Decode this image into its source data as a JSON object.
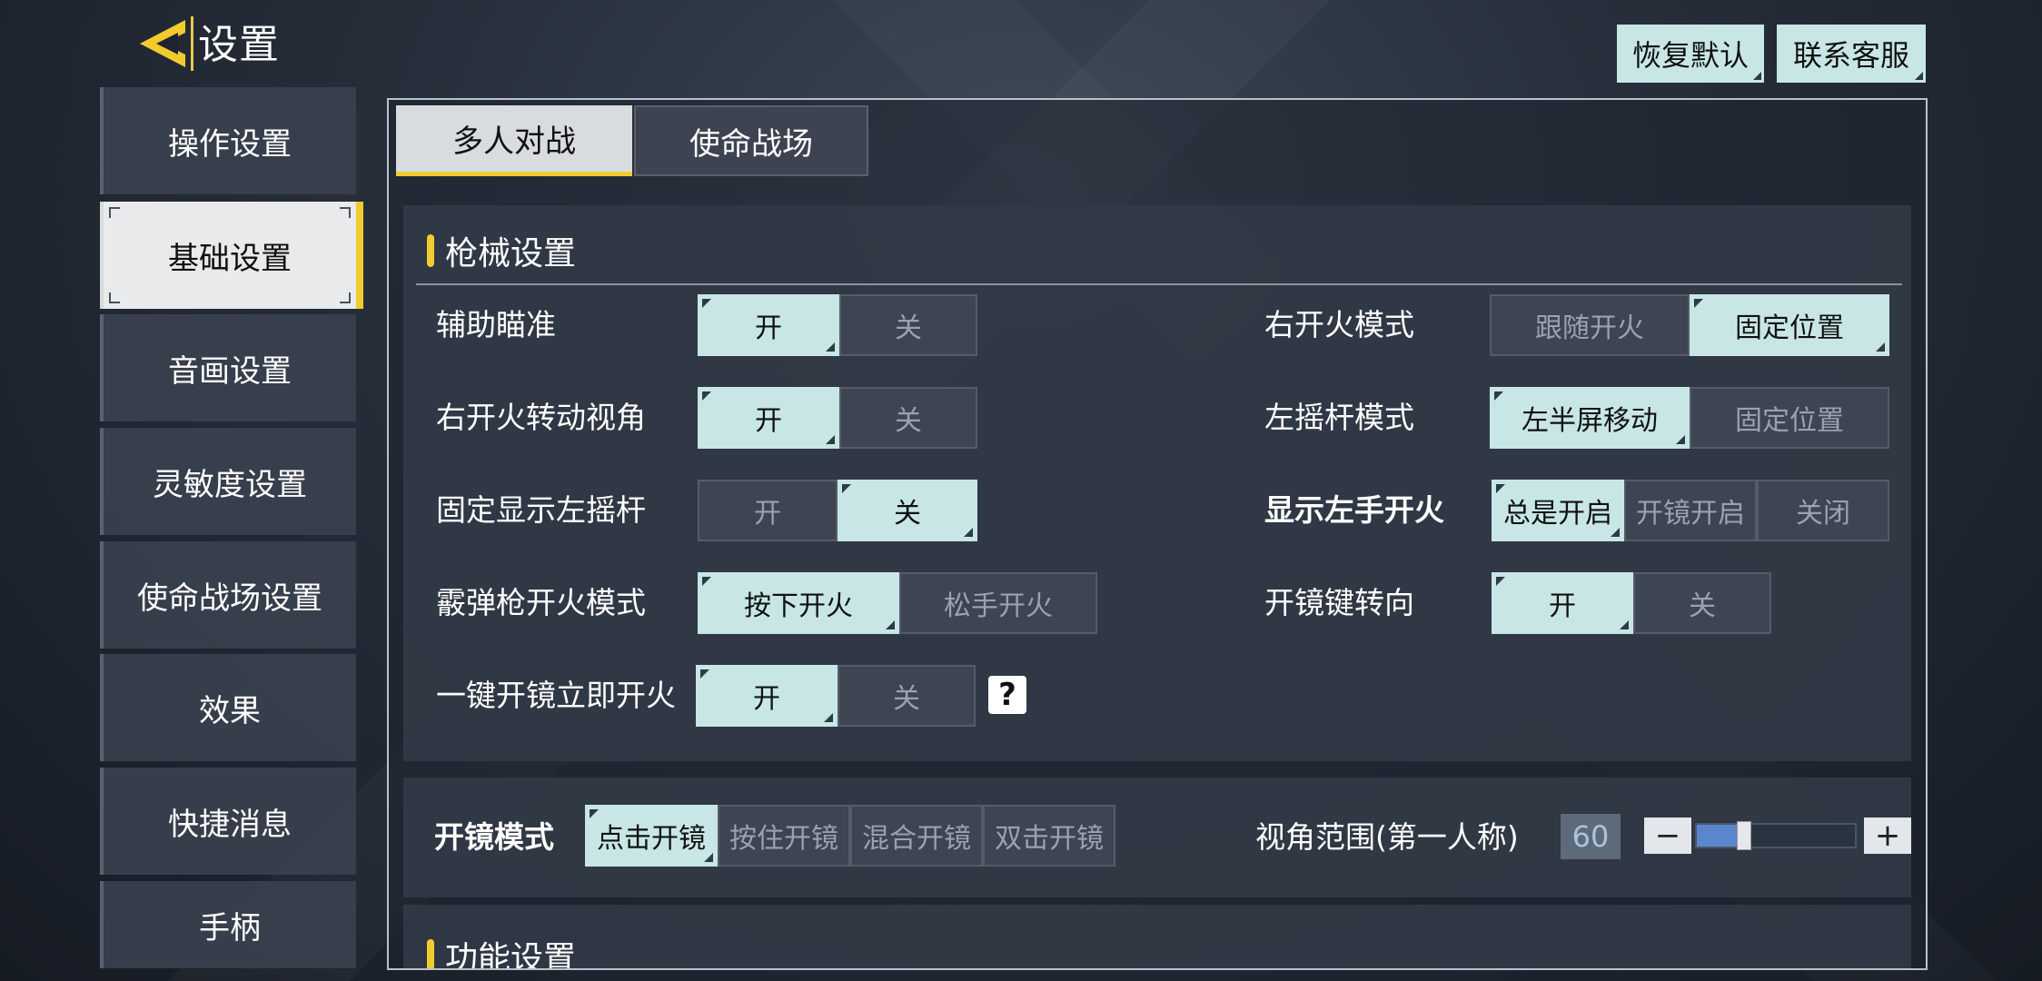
{
  "header": {
    "title": "设置",
    "restore_default": "恢复默认",
    "contact_support": "联系客服"
  },
  "sidebar": {
    "items": [
      {
        "label": "操作设置"
      },
      {
        "label": "基础设置"
      },
      {
        "label": "音画设置"
      },
      {
        "label": "灵敏度设置"
      },
      {
        "label": "使命战场设置"
      },
      {
        "label": "效果"
      },
      {
        "label": "快捷消息"
      },
      {
        "label": "手柄"
      }
    ],
    "active_index": 1
  },
  "tabs": [
    {
      "label": "多人对战"
    },
    {
      "label": "使命战场"
    }
  ],
  "gun_settings": {
    "title": "枪械设置",
    "left": [
      {
        "label": "辅助瞄准",
        "options": [
          "开",
          "关"
        ],
        "selected": 0
      },
      {
        "label": "右开火转动视角",
        "options": [
          "开",
          "关"
        ],
        "selected": 0
      },
      {
        "label": "固定显示左摇杆",
        "options": [
          "开",
          "关"
        ],
        "selected": 1
      },
      {
        "label": "霰弹枪开火模式",
        "options": [
          "按下开火",
          "松手开火"
        ],
        "selected": 0
      },
      {
        "label": "一键开镜立即开火",
        "options": [
          "开",
          "关"
        ],
        "selected": 0,
        "help": "?"
      }
    ],
    "right": [
      {
        "label": "右开火模式",
        "options": [
          "跟随开火",
          "固定位置"
        ],
        "selected": 1
      },
      {
        "label": "左摇杆模式",
        "options": [
          "左半屏移动",
          "固定位置"
        ],
        "selected": 0
      },
      {
        "label": "显示左手开火",
        "options": [
          "总是开启",
          "开镜开启",
          "关闭"
        ],
        "selected": 0
      },
      {
        "label": "开镜键转向",
        "options": [
          "开",
          "关"
        ],
        "selected": 0
      }
    ]
  },
  "scope_settings": {
    "mode_label": "开镜模式",
    "mode_options": [
      "点击开镜",
      "按住开镜",
      "混合开镜",
      "双击开镜"
    ],
    "mode_selected": 0,
    "fov_label": "视角范围(第一人称)",
    "fov_value": "60",
    "fov_fraction": 0.3,
    "minus": "−",
    "plus": "+"
  },
  "function_settings": {
    "title": "功能设置"
  },
  "colors": {
    "accent_yellow": "#f2cc2e",
    "selected_option": "#c8e6e6",
    "slider_fill": "#5a86cc"
  },
  "icons": {
    "back": "back-arrow-icon",
    "help": "question-mark-icon"
  }
}
